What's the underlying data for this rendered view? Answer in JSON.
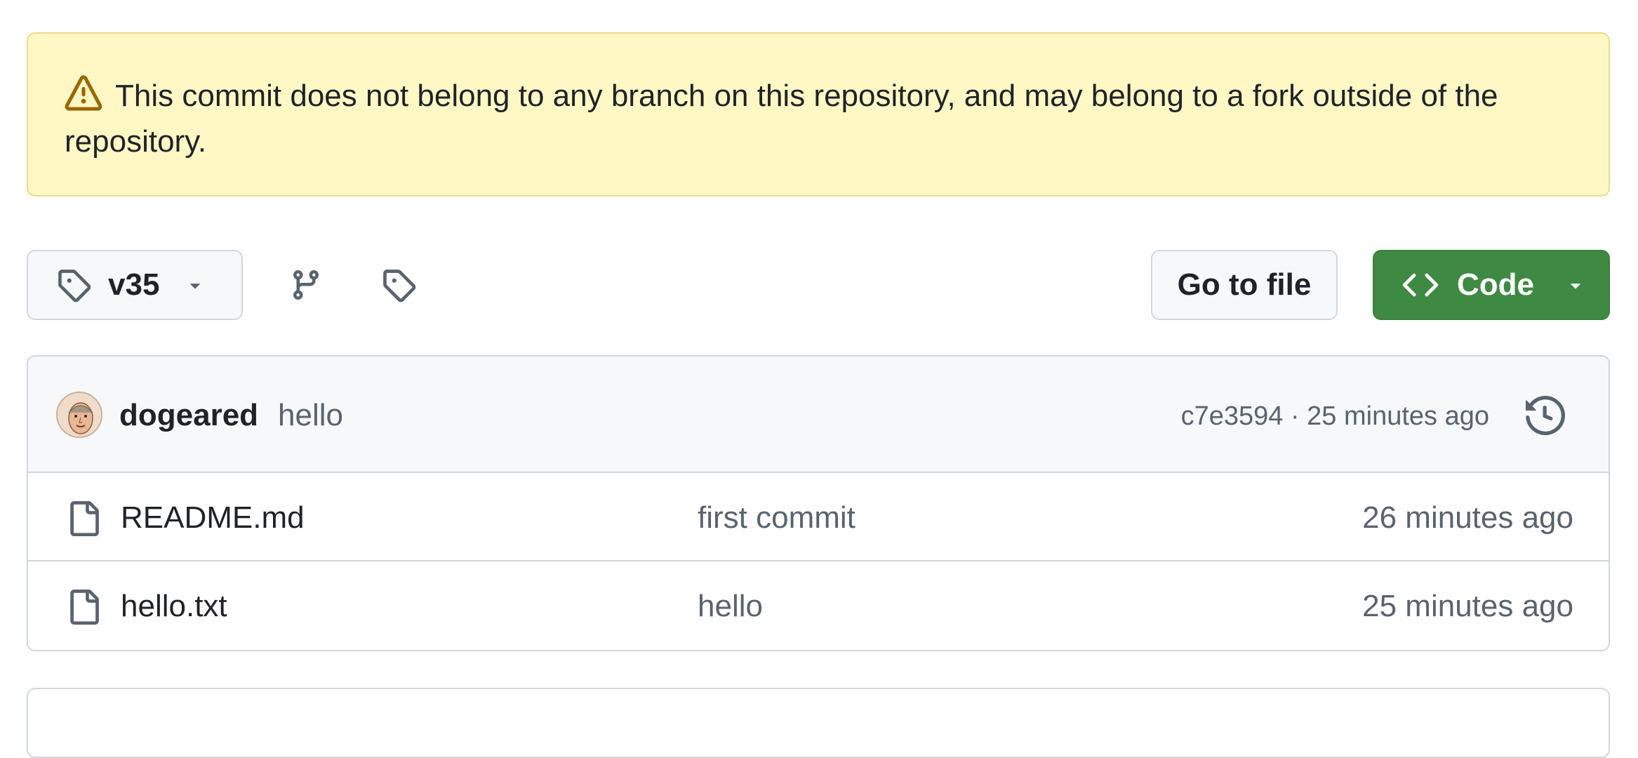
{
  "flash": {
    "message": "This commit does not belong to any branch on this repository, and may belong to a fork outside of the repository.",
    "icon": "alert-icon"
  },
  "toolbar": {
    "ref_label": "v35",
    "go_to_file_label": "Go to file",
    "code_label": "Code"
  },
  "latest_commit": {
    "author": "dogeared",
    "message": "hello",
    "sha": "c7e3594",
    "time": "25 minutes ago",
    "meta": "c7e3594 · 25 minutes ago"
  },
  "files": [
    {
      "name": "README.md",
      "commit_message": "first commit",
      "time": "26 minutes ago"
    },
    {
      "name": "hello.txt",
      "commit_message": "hello",
      "time": "25 minutes ago"
    }
  ],
  "colors": {
    "flash_bg": "#fff8c5",
    "flash_border": "#efd987",
    "code_button": "#3f8a42",
    "muted_text": "#59636e",
    "border": "#d0d7de"
  }
}
